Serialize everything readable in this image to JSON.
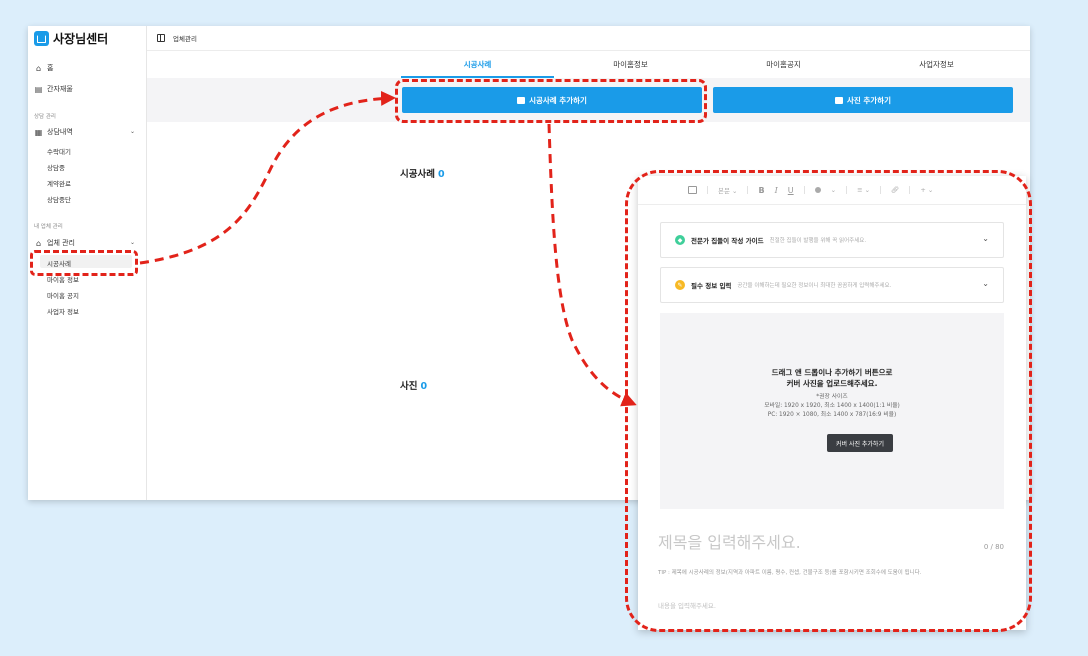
{
  "app": {
    "logo_text": "사장님센터",
    "breadcrumb": "업체관리"
  },
  "sidebar": {
    "home": "홈",
    "cover_letter": "간자재울",
    "section_consult": "상담 관리",
    "consult_history": "상담내역",
    "consult_subitems": [
      "수락대기",
      "상담중",
      "계약완료",
      "상담중단"
    ],
    "section_company": "내 업체 관리",
    "company_manage": "업체 관리",
    "company_subitems": [
      "시공사례",
      "마이홈 정보",
      "마이홈 공지",
      "사업자 정보"
    ]
  },
  "tabs": [
    "시공사례",
    "마이홈정보",
    "마이홈공지",
    "사업자정보"
  ],
  "actions": {
    "add_case": "시공사례 추가하기",
    "add_photo": "사진 추가하기"
  },
  "sections": {
    "cases_title": "시공사례",
    "cases_count": "0",
    "photos_title": "사진",
    "photos_count": "0"
  },
  "editor": {
    "toolbar_style": "본문",
    "toolbar_bold": "B",
    "toolbar_italic": "I",
    "toolbar_underline": "U",
    "toolbar_plus": "+",
    "guide_title": "전문가 집들이 작성 가이드",
    "guide_desc": "친절한 집들이 발행을 위해 꼭 읽어주세요.",
    "required_title": "필수 정보 입력",
    "required_desc": "공간을 이해하는데 필요한 정보이니 최대한 꼼꼼하게 입력해주세요.",
    "drop_line1": "드래그 앤 드롭이나 추가하기 버튼으로",
    "drop_line2": "커버 사진을 업로드해주세요.",
    "rec_title": "*권장 사이즈",
    "rec_mobile": "모바일: 1920 x 1920, 최소 1400 x 1400(1:1 비율)",
    "rec_pc": "PC: 1920 × 1080, 최소 1400 x 787(16:9 비율)",
    "add_cover_button": "커버 사진 추가하기",
    "title_placeholder": "제목을 입력해주세요.",
    "char_count": "0 / 80",
    "tip": "TIP : 제목에 시공사례의 정보(지역과 아파트 이름, 평수, 컨셉, 건물구조 등)를 포함시키면 조회수에 도움이 됩니다.",
    "body_placeholder": "내용을 입력해주세요."
  },
  "colors": {
    "accent": "#1a9be8",
    "annotation": "#e2231a"
  }
}
